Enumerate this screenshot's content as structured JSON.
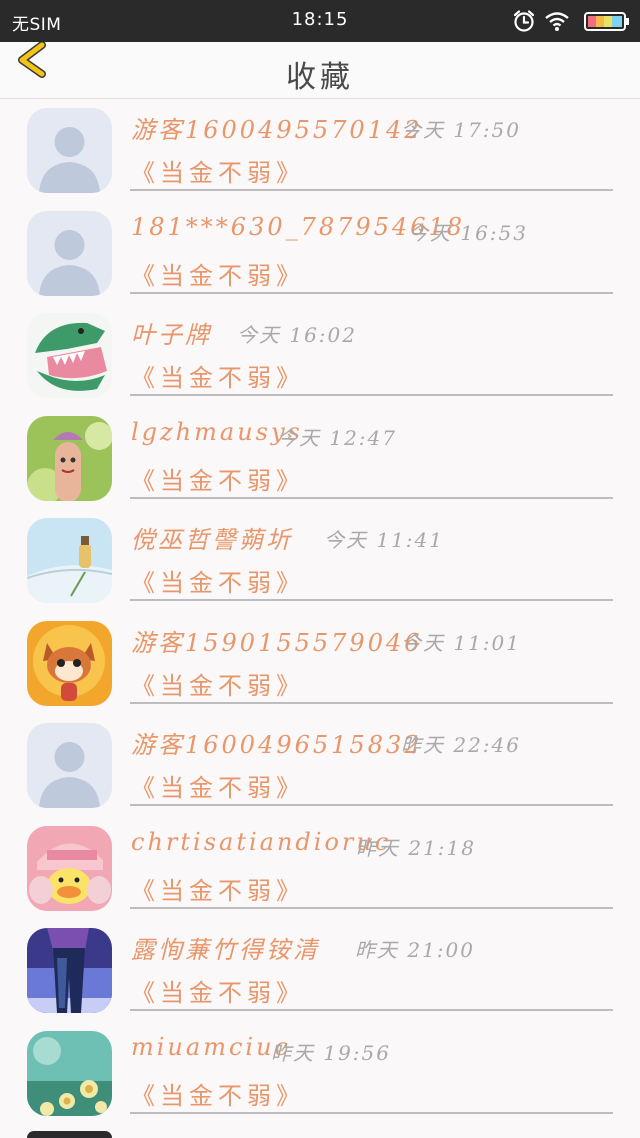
{
  "status_bar": {
    "carrier": "无SIM",
    "time": "18:15",
    "icons": [
      "alarm-icon",
      "wifi-icon",
      "battery-icon"
    ]
  },
  "nav": {
    "back_icon": "chevron-left-icon",
    "title": "收藏"
  },
  "colors": {
    "accent": "#e8966a",
    "time_text": "#a9a9a9",
    "back_arrow": "#f2c418",
    "status_bar_bg": "#2a2a2a"
  },
  "favorites": [
    {
      "name": "游客1600495570142",
      "time": "今天 17:50",
      "title": "《当金不弱》",
      "avatar": "default-avatar"
    },
    {
      "name": "181***630_787954618",
      "time": "今天 16:53",
      "title": "《当金不弱》",
      "avatar": "default-avatar"
    },
    {
      "name": "叶子牌",
      "time": "今天 16:02",
      "title": "《当金不弱》",
      "avatar": "dinosaur-avatar"
    },
    {
      "name": "lgzhmausys",
      "time": "今天 12:47",
      "title": "《当金不弱》",
      "avatar": "finger-doll-avatar"
    },
    {
      "name": "傥巫哲謦蒴圻",
      "time": "今天 11:41",
      "title": "《当金不弱》",
      "avatar": "book-bottle-avatar"
    },
    {
      "name": "游客1590155579046",
      "time": "今天 11:01",
      "title": "《当金不弱》",
      "avatar": "raccoon-avatar"
    },
    {
      "name": "游客1600496515832",
      "time": "昨天 22:46",
      "title": "《当金不弱》",
      "avatar": "default-avatar"
    },
    {
      "name": "chrtisatiandioruc",
      "time": "昨天 21:18",
      "title": "《当金不弱》",
      "avatar": "duck-avatar"
    },
    {
      "name": "露恂蒹竹得铵清",
      "time": "昨天 21:00",
      "title": "《当金不弱》",
      "avatar": "dancer-avatar"
    },
    {
      "name": "miuamciuc",
      "time": "昨天 19:56",
      "title": "《当金不弱》",
      "avatar": "dandelion-avatar"
    }
  ]
}
